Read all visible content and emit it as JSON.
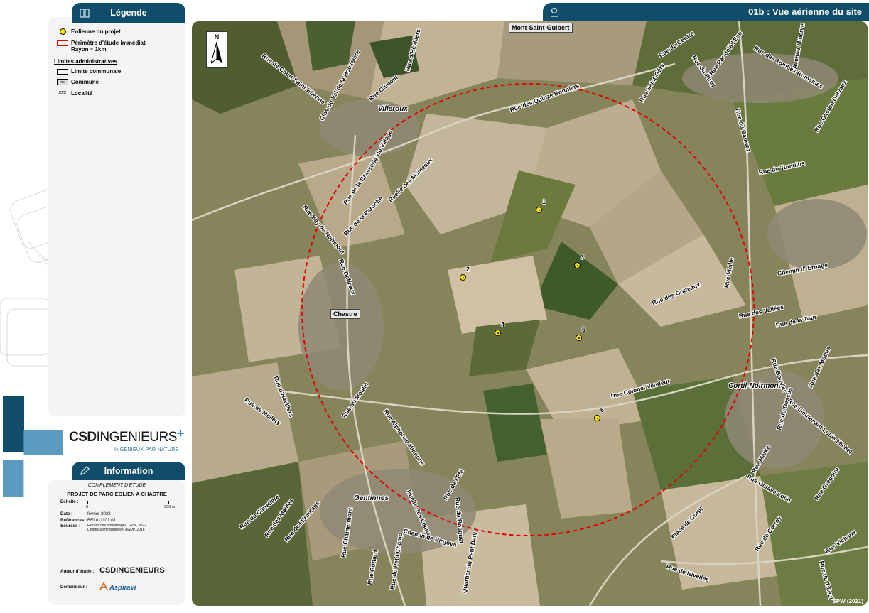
{
  "legend": {
    "header": "Légende",
    "items": [
      {
        "label": "Eolienne du projet"
      },
      {
        "label": "Périmètre d'étude immédiat\nRayon = 1km"
      }
    ],
    "admin_title": "Limites administratives",
    "admin_items": [
      {
        "label": "Limite communale"
      },
      {
        "label": "Commune",
        "symbol_text": "xxx"
      },
      {
        "label": "Localité",
        "symbol_text": "xxx"
      }
    ]
  },
  "logo": {
    "main_bold": "CSD",
    "main_light": "INGENIEURS",
    "plus": "+",
    "tagline": "INGÉNIEUX PAR NATURE"
  },
  "info": {
    "header": "Information",
    "subtitle": "COMPLEMENT D'ETUDE",
    "project": "PROJET DE PARC EOLIEN A CHASTRE",
    "scale_label": "Echelle :",
    "scale_start": "0",
    "scale_end": "500  m",
    "date_label": "Date :",
    "date_value": "février 2022",
    "ref_label": "Références :",
    "ref_value": "BEL011101.01",
    "sources_label": "Sources :",
    "sources_line1": "Extraits des orthoimages, SPW, 2022",
    "sources_line2": "Limites administratives, AGDP, 2016",
    "author_label": "Auteur d'étude :",
    "author_value": "CSDINGENIEURS",
    "requester_label": "Demandeur :",
    "requester_value": "Aspiravi"
  },
  "map": {
    "title": "01b : Vue aérienne du site",
    "north": "N",
    "credit": "SPW (2021)",
    "communes": [
      "Mont-Saint-Guibert",
      "Chastre"
    ],
    "localities": [
      "Villeroux",
      "Cortil-Noirmont",
      "Gentinnes"
    ],
    "turbines": [
      "1",
      "2",
      "3",
      "4",
      "5",
      "6"
    ],
    "streets": [
      "Rue de Court Saint-Etienne",
      "Clos du Val de la Houssière",
      "Rue Gilmont",
      "Rue d'Hévillers",
      "Rue des Quinze Bonniers",
      "Rue Saint-Géry",
      "Rue du Centre",
      "Rue du Piroy",
      "Rue Par delà l'Eau",
      "Rue des Tombes Romaines",
      "Avenue Minerve",
      "Rue Gaston Delvaux",
      "Rue du Bauwez",
      "Rue du Village",
      "Rue de la Brasserie",
      "Ruelle des Moineaux",
      "Rue de la Paroche",
      "Rue Bay de Noirmont",
      "Rue du Tumulus",
      "Rue Deffreux",
      "Rue Vieille",
      "Chemin d' Ernage",
      "Rue des Gotteaux",
      "Rue des Vallées",
      "Rue de la Tour",
      "Rue d'Hévillers",
      "Rue de Mellery",
      "Rue Colonel Vendeur",
      "Rue du Moulin",
      "Rue Alphonse Minnone",
      "Rue des Mottes",
      "Rue Bouvier",
      "Rue Lieutenant Louis Michel",
      "Rue du Dessus",
      "Rue Marka",
      "Rue Octave Lotin",
      "Rue Grégoire",
      "Rue du Cimetière",
      "Rue des Mailles",
      "Rue de l'Ermitage",
      "Ruelle des Loups",
      "Rue de l'Eté",
      "Rue du Bosquet",
      "Chemin de Pirgova",
      "Rue Chamermont",
      "Rue Gottard",
      "Rue du Petit Champ",
      "Quartier du Petit Baty",
      "Place de Cortil",
      "Rue de Corroy",
      "Rue de Nivelles",
      "Rue Vichaux",
      "Rue du Tilleul"
    ]
  }
}
